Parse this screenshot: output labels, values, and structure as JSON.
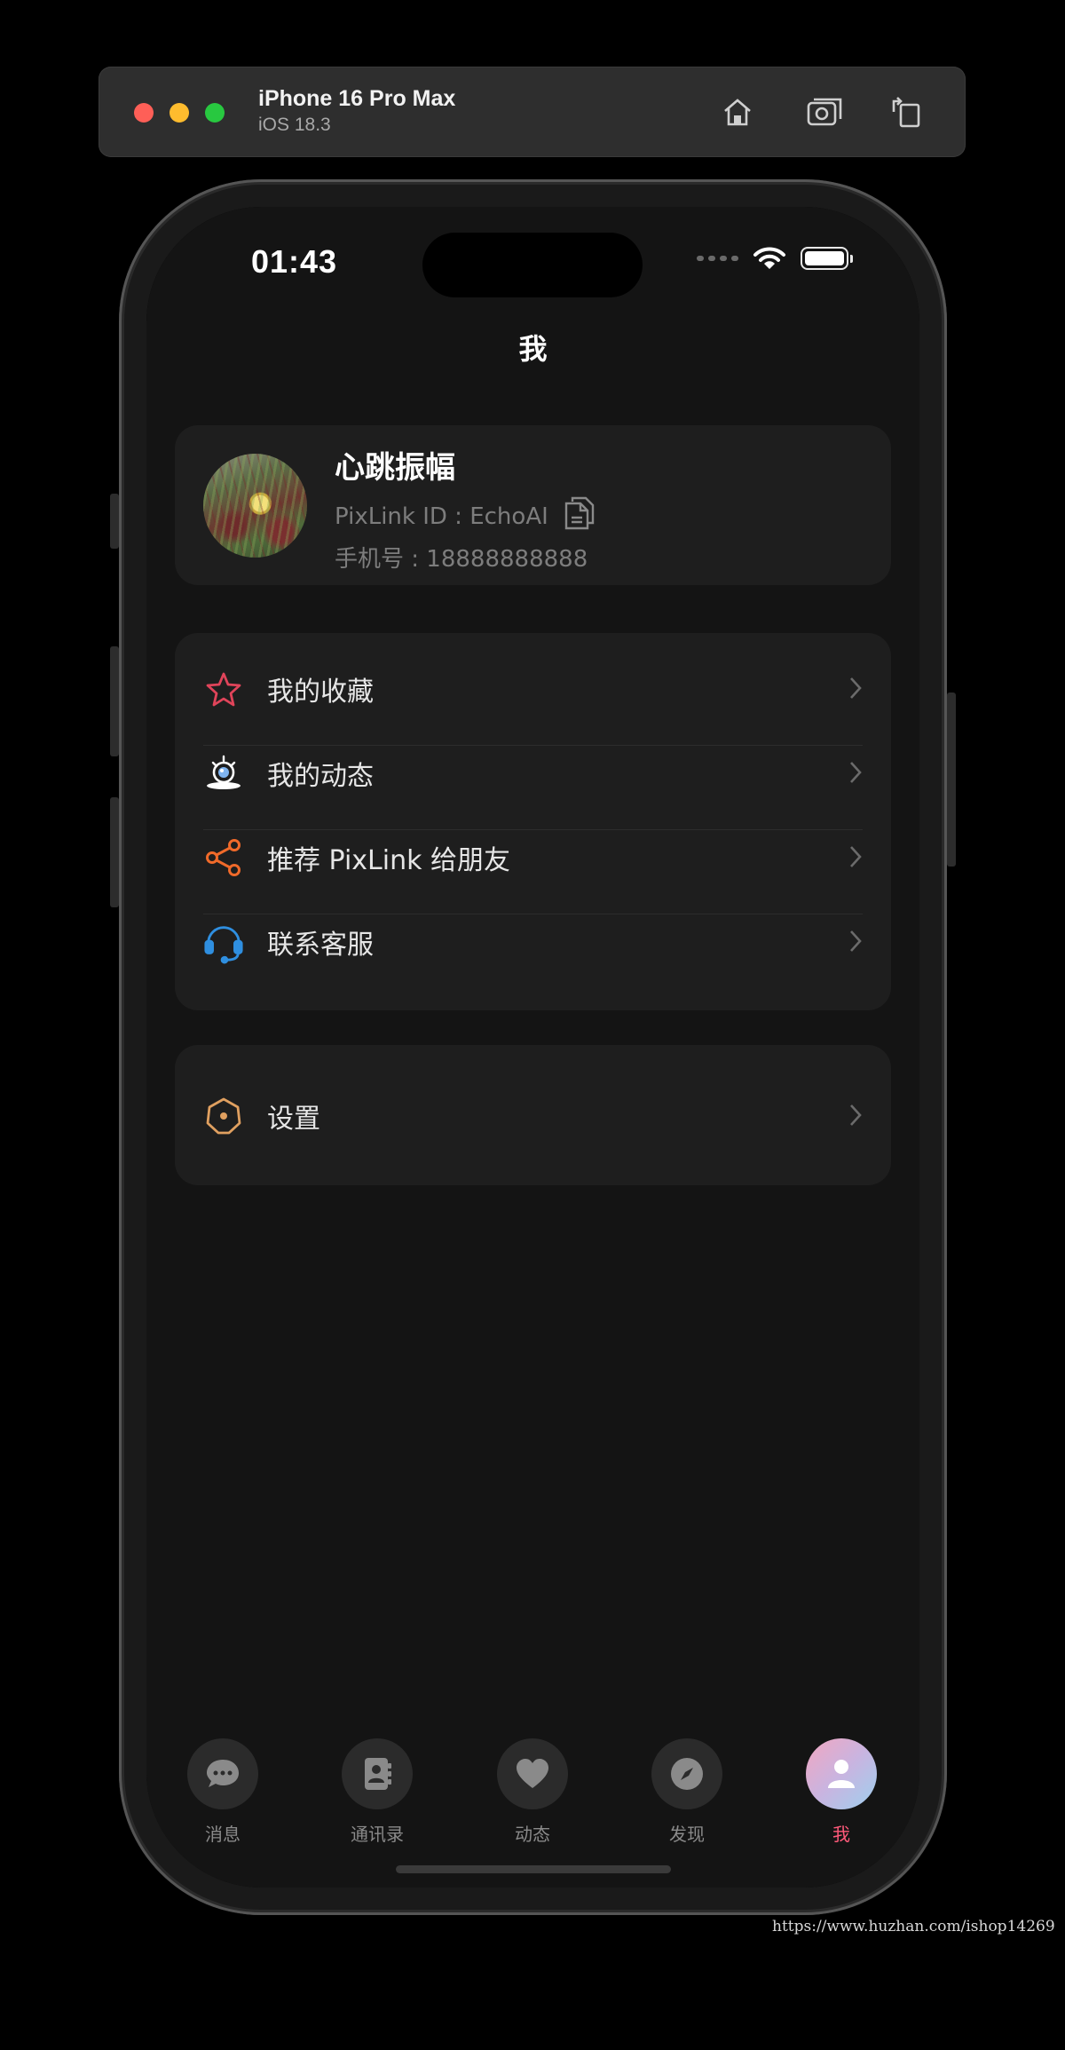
{
  "simulator": {
    "device_name": "iPhone 16 Pro Max",
    "os_version": "iOS 18.3",
    "buttons": [
      "home-icon",
      "screenshot-icon",
      "rotate-icon"
    ]
  },
  "status_bar": {
    "time": "01:43",
    "battery_level": 1.0
  },
  "page": {
    "title": "我"
  },
  "profile": {
    "name": "心跳振幅",
    "id_text": "PixLink ID : EchoAI",
    "phone_text": "手机号 : 18888888888"
  },
  "menu": {
    "items": [
      {
        "label": "我的收藏",
        "icon": "star-icon",
        "color": "#e0445a"
      },
      {
        "label": "我的动态",
        "icon": "moments-icon",
        "color": "#ffffff"
      },
      {
        "label": "推荐 PixLink 给朋友",
        "icon": "share-icon",
        "color": "#f06a2a"
      },
      {
        "label": "联系客服",
        "icon": "headset-icon",
        "color": "#2f8fe0"
      }
    ]
  },
  "settings": {
    "label": "设置",
    "icon": "settings-icon",
    "color": "#e0a060"
  },
  "tabbar": {
    "tabs": [
      {
        "label": "消息",
        "icon": "chat-icon",
        "active": false
      },
      {
        "label": "通讯录",
        "icon": "contacts-icon",
        "active": false
      },
      {
        "label": "动态",
        "icon": "heart-icon",
        "active": false
      },
      {
        "label": "发现",
        "icon": "compass-icon",
        "active": false
      },
      {
        "label": "我",
        "icon": "person-icon",
        "active": true
      }
    ],
    "active_color": "#ff5a7a"
  },
  "watermark": "https://www.huzhan.com/ishop14269"
}
